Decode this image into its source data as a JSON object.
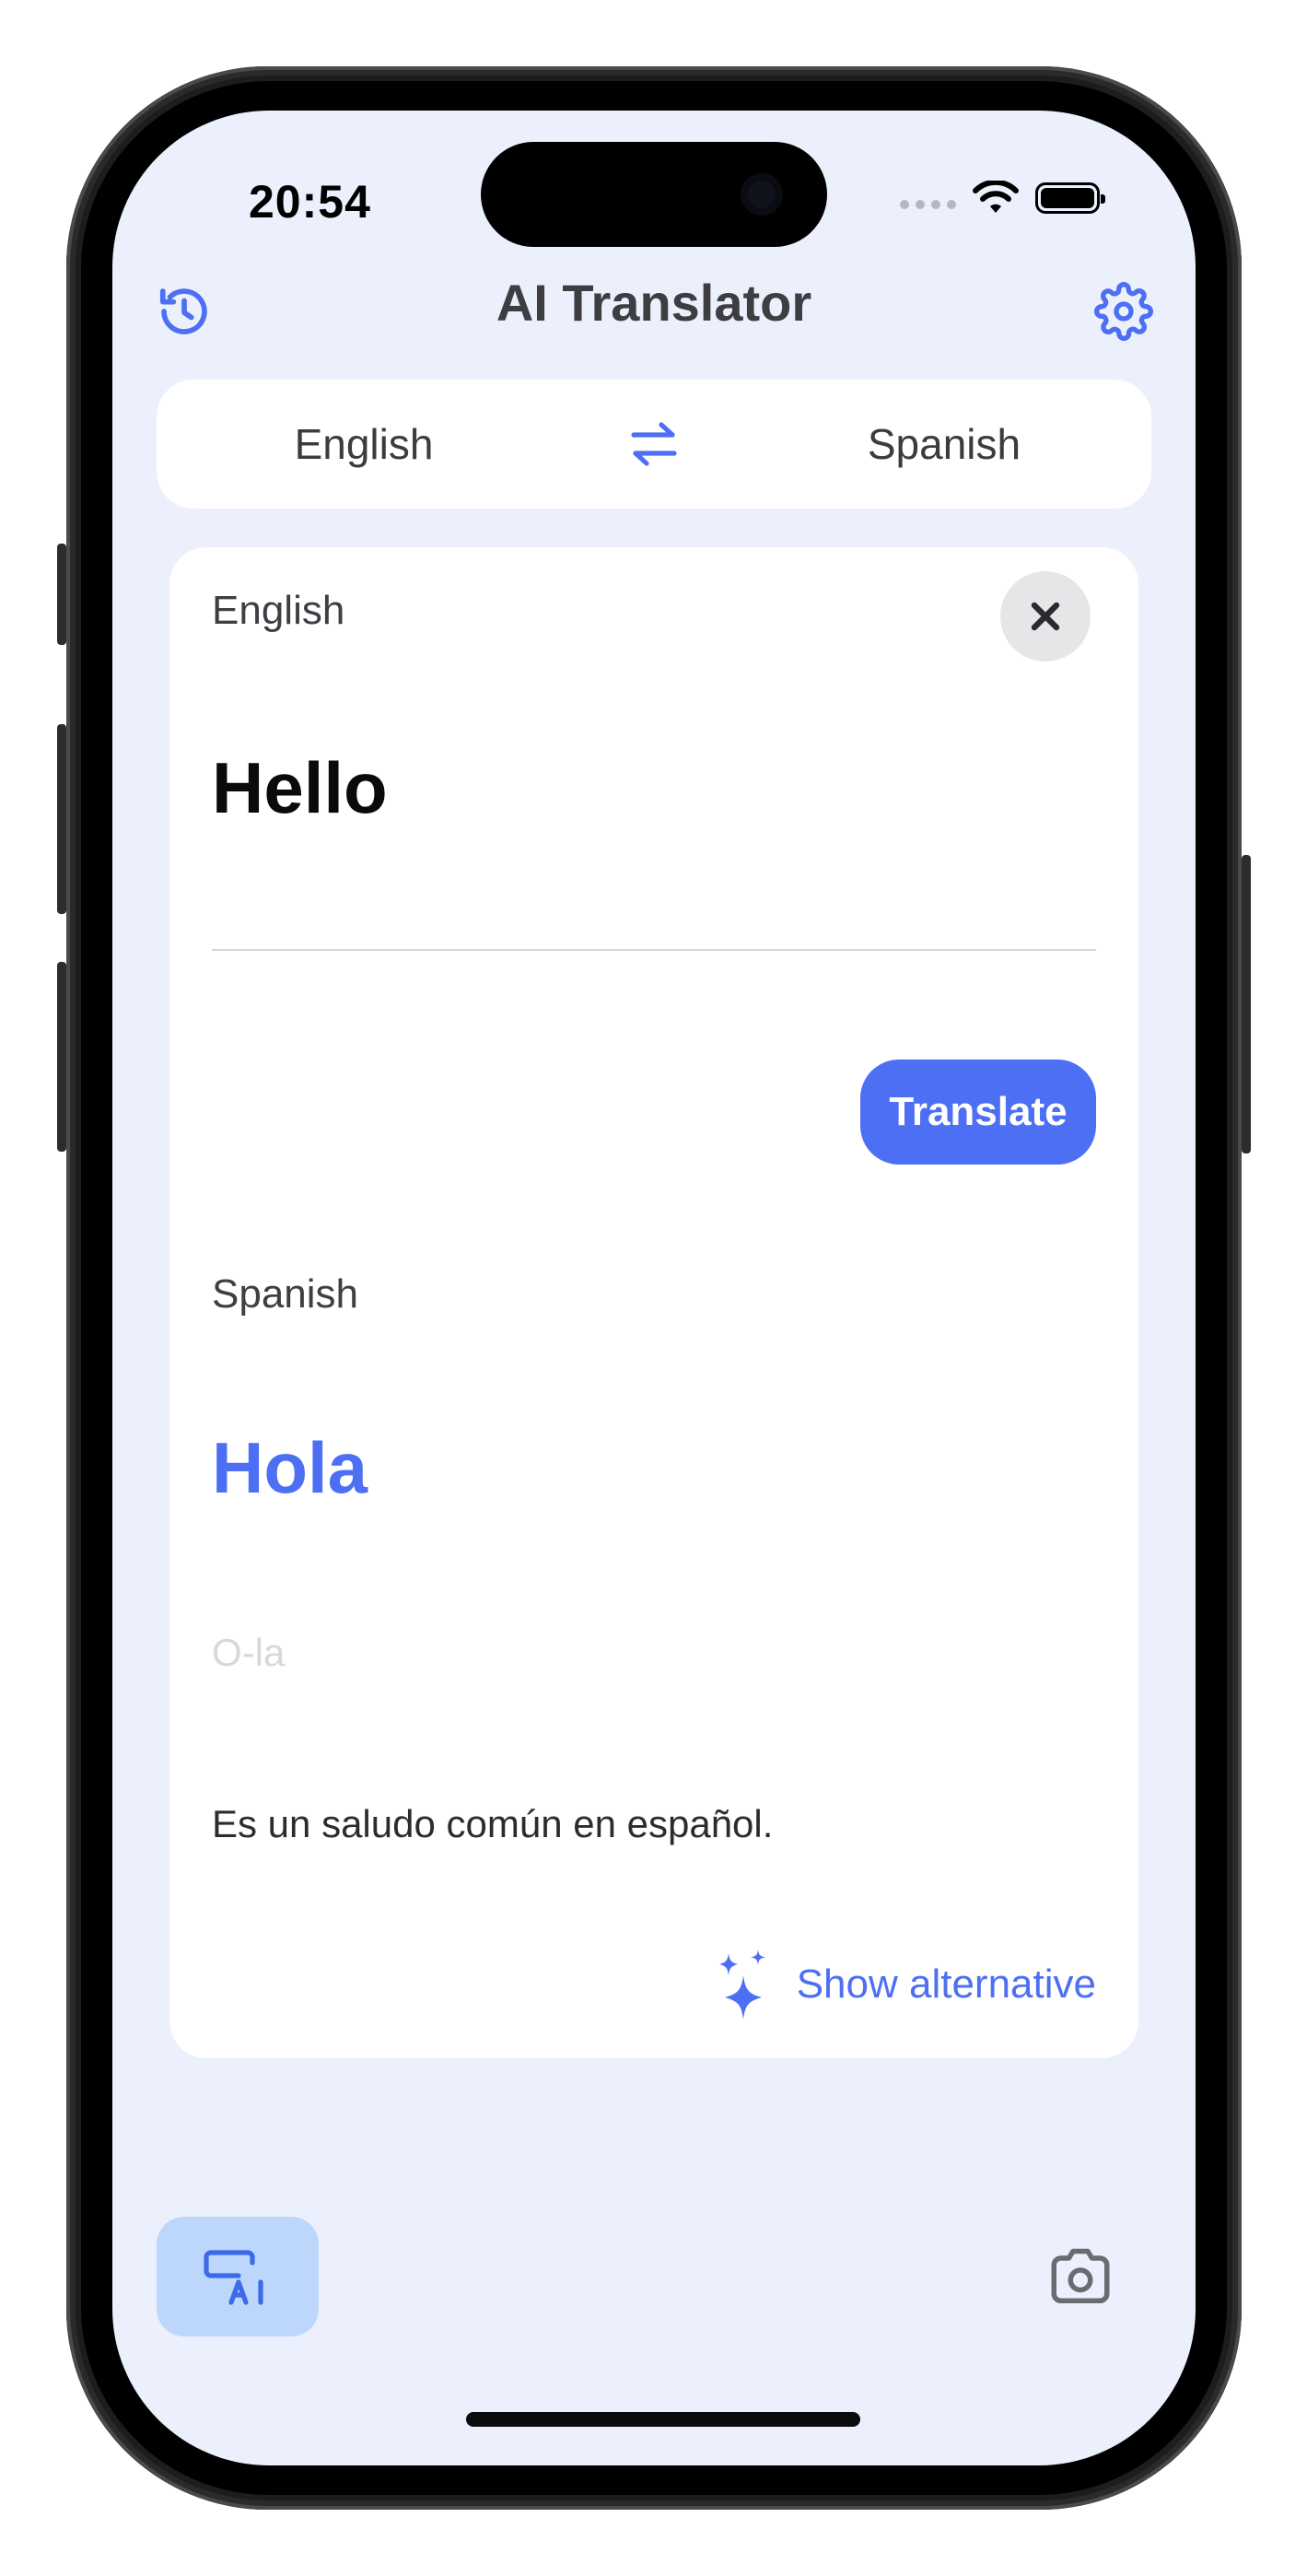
{
  "status_bar": {
    "time": "20:54"
  },
  "header": {
    "title": "AI Translator",
    "history_icon": "history-icon",
    "settings_icon": "gear-icon"
  },
  "language_bar": {
    "source": "English",
    "target": "Spanish",
    "swap_icon": "swap-arrows-icon"
  },
  "input": {
    "language_label": "English",
    "text": "Hello",
    "clear_icon": "close-icon"
  },
  "translate_button": "Translate",
  "output": {
    "language_label": "Spanish",
    "translation": "Hola",
    "pronunciation": "O-la",
    "explanation": "Es un saludo común en español.",
    "alternative_label": "Show alternative",
    "alternative_icon": "sparkles-icon"
  },
  "tabs": {
    "ai_tab_icon": "ai-translate-icon",
    "camera_tab_icon": "camera-icon"
  },
  "colors": {
    "accent": "#4d6ff3",
    "background": "#ecf0fd",
    "card": "#ffffff",
    "active_tab": "#bcd7fb"
  }
}
